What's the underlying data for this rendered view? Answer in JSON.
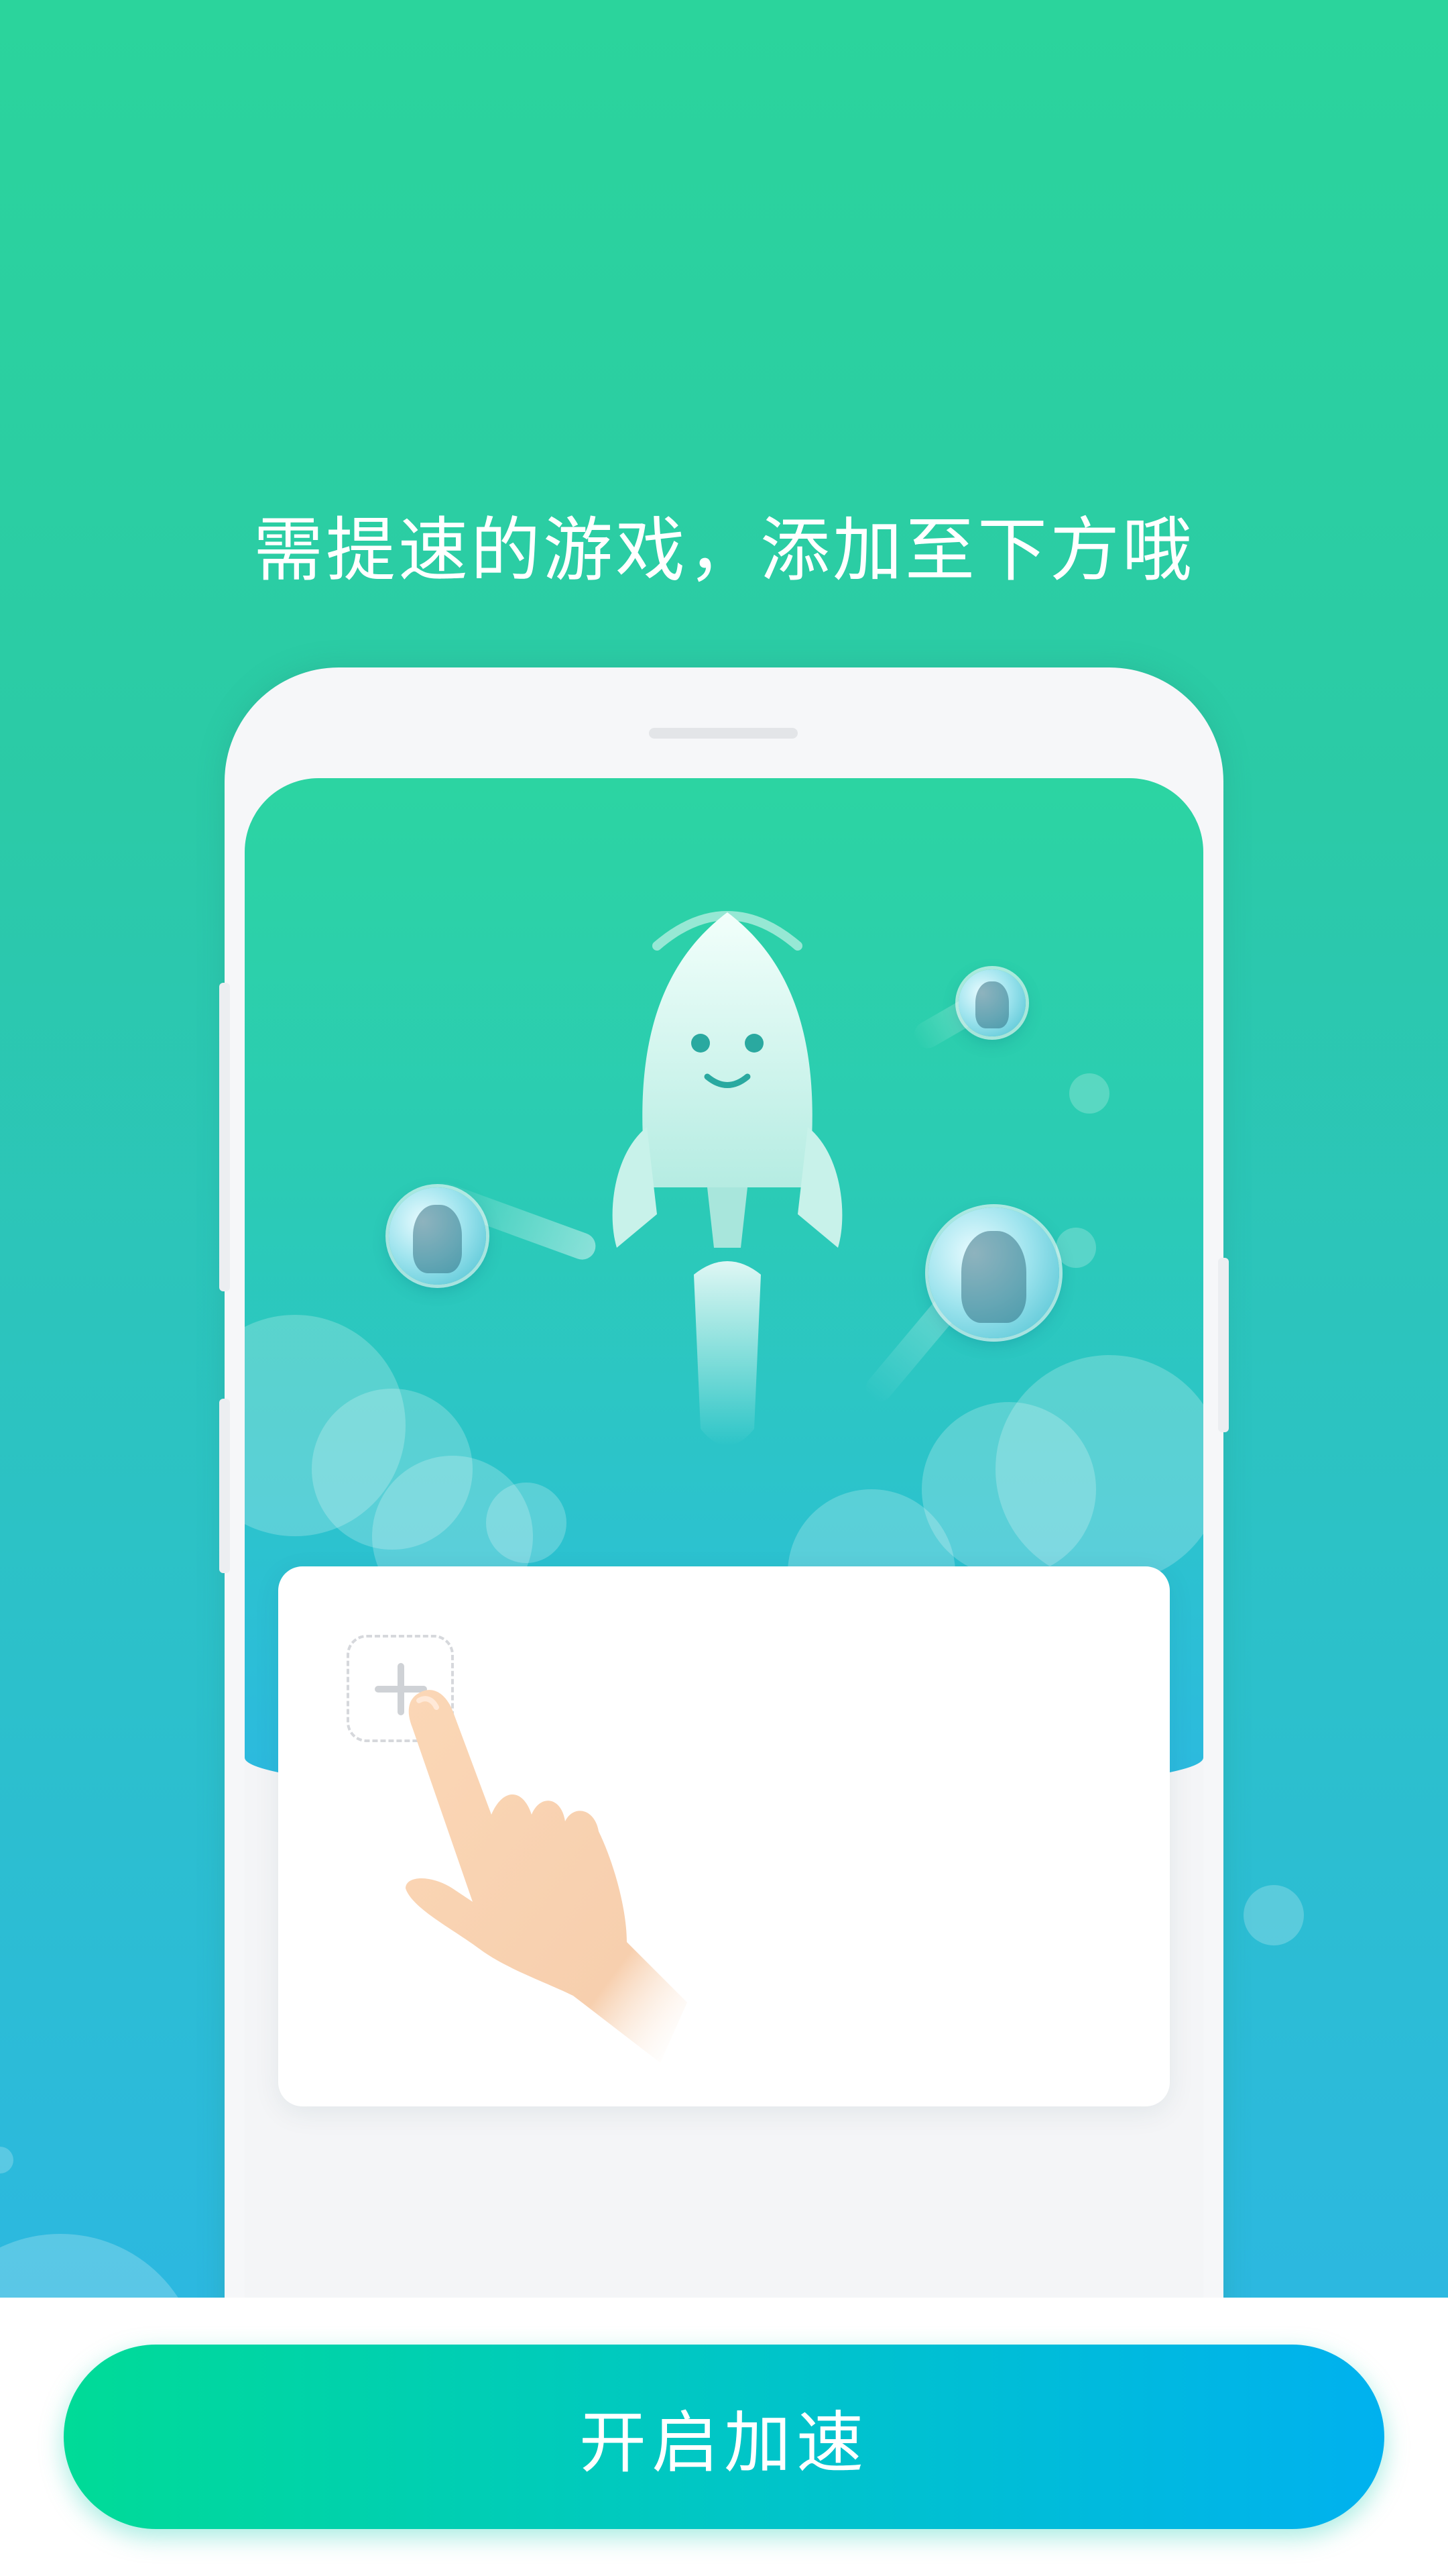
{
  "onboarding": {
    "headline": "需提速的游戏，添加至下方哦",
    "illustration": {
      "rocket_icon": "rocket-icon",
      "game_avatars": [
        "game-avatar-icon",
        "game-avatar-icon",
        "game-avatar-icon"
      ],
      "add_slot_icon": "plus-icon",
      "pointer_icon": "hand-pointer-icon"
    }
  },
  "action": {
    "start_label": "开启加速"
  },
  "colors": {
    "brand_green": "#00db97",
    "brand_blue": "#00b1ef",
    "background_top": "#2bd49c",
    "background_bottom": "#2cb8e0",
    "card": "#ffffff"
  }
}
